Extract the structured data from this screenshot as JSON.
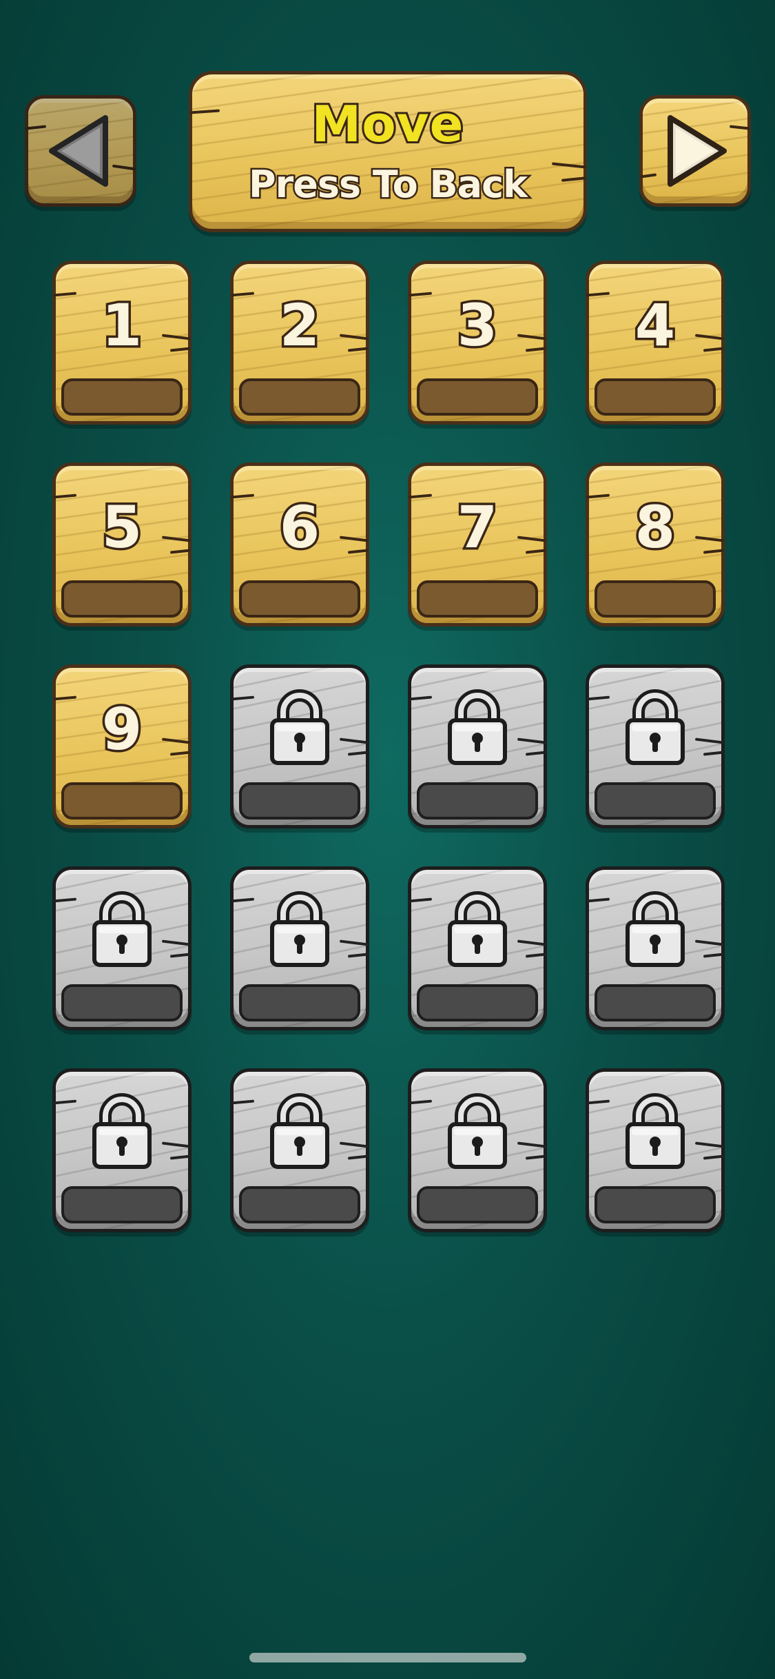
{
  "header": {
    "title": "Move",
    "subtitle": "Press To Back",
    "prev_icon": "triangle-left-icon",
    "next_icon": "triangle-right-icon"
  },
  "levels": [
    {
      "label": "1",
      "locked": false
    },
    {
      "label": "2",
      "locked": false
    },
    {
      "label": "3",
      "locked": false
    },
    {
      "label": "4",
      "locked": false
    },
    {
      "label": "5",
      "locked": false
    },
    {
      "label": "6",
      "locked": false
    },
    {
      "label": "7",
      "locked": false
    },
    {
      "label": "8",
      "locked": false
    },
    {
      "label": "9",
      "locked": false
    },
    {
      "label": "",
      "locked": true
    },
    {
      "label": "",
      "locked": true
    },
    {
      "label": "",
      "locked": true
    },
    {
      "label": "",
      "locked": true
    },
    {
      "label": "",
      "locked": true
    },
    {
      "label": "",
      "locked": true
    },
    {
      "label": "",
      "locked": true
    },
    {
      "label": "",
      "locked": true
    },
    {
      "label": "",
      "locked": true
    },
    {
      "label": "",
      "locked": true
    },
    {
      "label": "",
      "locked": true
    }
  ],
  "colors": {
    "background": "#0a4f48",
    "wood": "#e9c55c",
    "stone": "#c6c6c6",
    "title_text": "#f1e222",
    "label_text": "#fbf4df",
    "outline": "#3a2616"
  }
}
